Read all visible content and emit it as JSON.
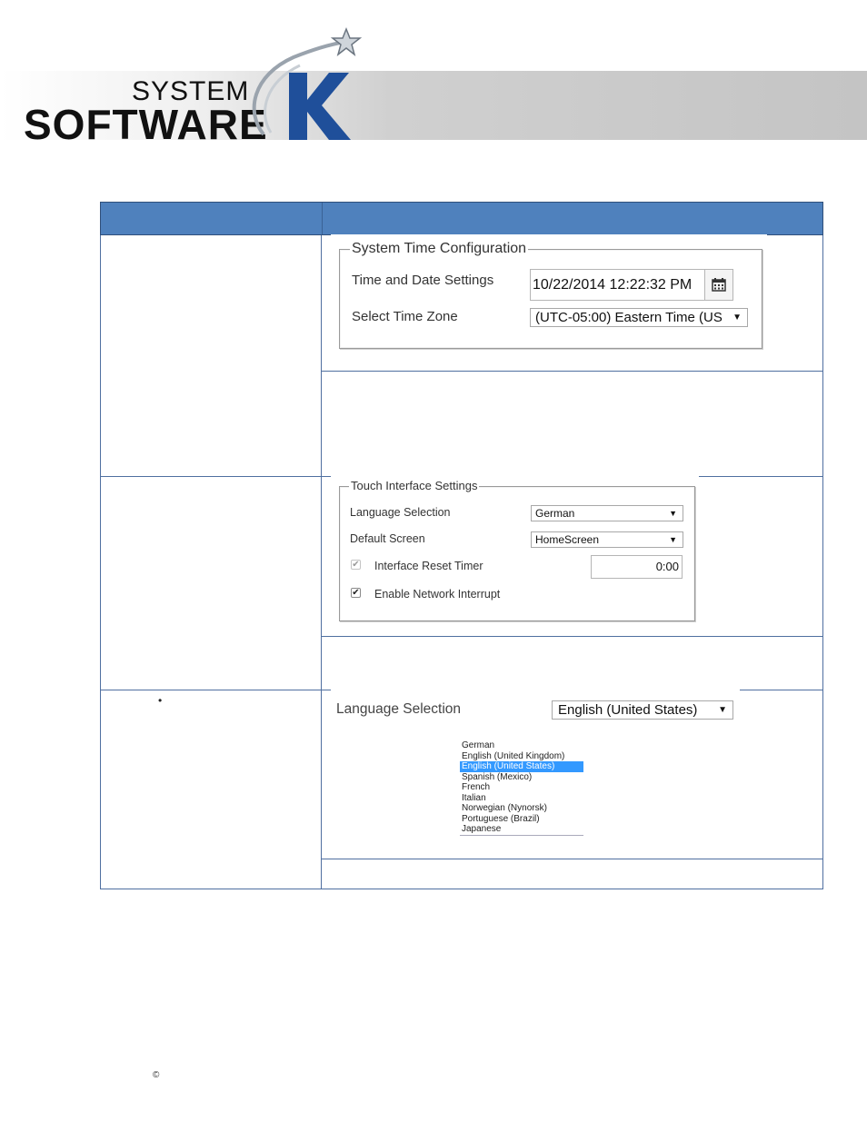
{
  "logo": {
    "line1": "SYSTEM",
    "line2": "SOFTWARE",
    "letter": "K"
  },
  "time_panel": {
    "legend": "System Time Configuration",
    "date_label": "Time and Date Settings",
    "date_value": "10/22/2014 12:22:32 PM",
    "zone_label": "Select Time Zone",
    "zone_value": "(UTC-05:00) Eastern Time (US"
  },
  "touch_panel": {
    "legend": "Touch Interface Settings",
    "language_label": "Language Selection",
    "language_value": "German",
    "screen_label": "Default Screen",
    "screen_value": "HomeScreen",
    "reset_label": "Interface Reset Timer",
    "reset_value": "0:00",
    "reset_checked": true,
    "network_label": "Enable Network Interrupt",
    "network_checked": true
  },
  "language_panel": {
    "label": "Language Selection",
    "value": "English (United States)",
    "options": [
      "German",
      "English (United Kingdom)",
      "English (United States)",
      "Spanish (Mexico)",
      "French",
      "Italian",
      "Norwegian (Nynorsk)",
      "Portuguese (Brazil)",
      "Japanese"
    ],
    "selected_index": 2
  },
  "bullet": "•",
  "copyright": "©",
  "colors": {
    "header_blue": "#4f81bd",
    "logo_blue": "#1f4f9a",
    "highlight": "#3399ff"
  },
  "icons": {
    "calendar": "calendar-icon",
    "dropdown": "chevron-down-icon",
    "check": "checkmark-icon"
  }
}
